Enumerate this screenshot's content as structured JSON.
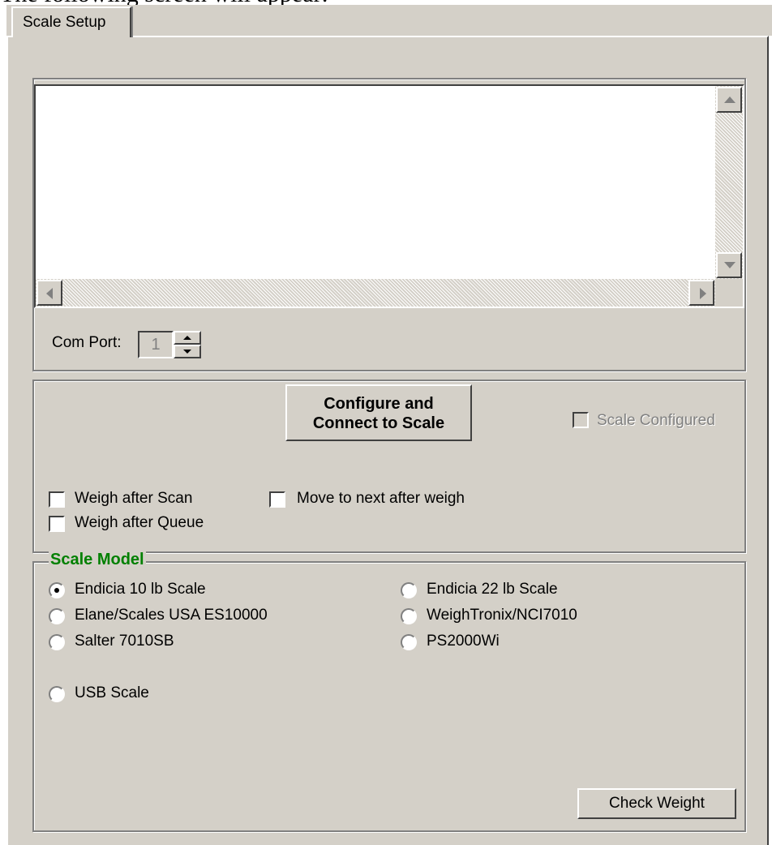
{
  "page_header": "The following screen will appear:",
  "tab": {
    "label": "Scale Setup"
  },
  "com_port": {
    "label": "Com Port:",
    "value": "1"
  },
  "configure": {
    "line1": "Configure and",
    "line2": "Connect to Scale"
  },
  "scale_configured": {
    "label": "Scale Configured",
    "checked": false,
    "enabled": false
  },
  "options": {
    "weigh_after_scan": {
      "label": "Weigh after Scan",
      "checked": false
    },
    "weigh_after_queue": {
      "label": "Weigh after Queue",
      "checked": false
    },
    "move_to_next": {
      "label": "Move to next after weigh",
      "checked": false
    }
  },
  "scale_model": {
    "title": "Scale Model",
    "options": [
      {
        "label": "Endicia 10 lb Scale",
        "checked": true
      },
      {
        "label": "Elane/Scales USA ES10000",
        "checked": false
      },
      {
        "label": "Salter 7010SB",
        "checked": false
      },
      {
        "label": "USB Scale",
        "checked": false
      },
      {
        "label": "Endicia 22 lb Scale",
        "checked": false
      },
      {
        "label": "WeighTronix/NCI7010",
        "checked": false
      },
      {
        "label": "PS2000Wi",
        "checked": false
      }
    ]
  },
  "check_weight": {
    "label": "Check Weight"
  },
  "colors": {
    "window_bg": "#d4d0c8",
    "group_title": "#008000"
  }
}
